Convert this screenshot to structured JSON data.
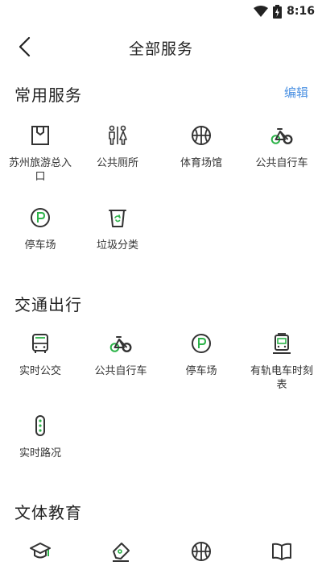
{
  "status": {
    "time": "8:16"
  },
  "header": {
    "title": "全部服务"
  },
  "sections": {
    "common": {
      "title": "常用服务",
      "edit_label": "编辑",
      "items": [
        {
          "label": "苏州旅游总入口",
          "icon": "portal-icon"
        },
        {
          "label": "公共厕所",
          "icon": "toilet-icon"
        },
        {
          "label": "体育场馆",
          "icon": "basketball-icon"
        },
        {
          "label": "公共自行车",
          "icon": "bicycle-icon"
        },
        {
          "label": "停车场",
          "icon": "parking-icon"
        },
        {
          "label": "垃圾分类",
          "icon": "trash-icon"
        }
      ]
    },
    "transport": {
      "title": "交通出行",
      "items": [
        {
          "label": "实时公交",
          "icon": "bus-icon"
        },
        {
          "label": "公共自行车",
          "icon": "bicycle-icon"
        },
        {
          "label": "停车场",
          "icon": "parking-icon"
        },
        {
          "label": "有轨电车时刻表",
          "icon": "tram-icon"
        },
        {
          "label": "实时路况",
          "icon": "traffic-light-icon"
        }
      ]
    },
    "culture": {
      "title": "文体教育",
      "items": [
        {
          "icon": "graduation-cap-icon"
        },
        {
          "icon": "pen-icon"
        },
        {
          "icon": "basketball-icon"
        },
        {
          "icon": "book-icon"
        }
      ]
    }
  },
  "colors": {
    "icon_dark": "#333333",
    "icon_green": "#2db34a",
    "accent_link": "#4a90e2"
  }
}
